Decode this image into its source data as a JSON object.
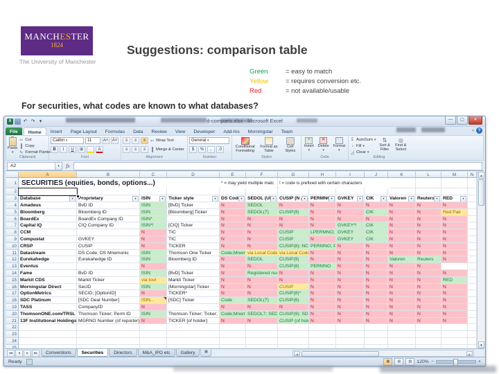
{
  "slide": {
    "logo": {
      "word_main": "MANCH",
      "word_gold": "ES",
      "word_rest": "TER",
      "year": "1824",
      "subtitle": "The University of Manchester"
    },
    "title": "Suggestions: comparison table",
    "legend": [
      {
        "label": "Green",
        "color": "#00a651",
        "desc": "= easy to match"
      },
      {
        "label": "Yellow",
        "color": "#f0c400",
        "desc": "= requires conversion etc."
      },
      {
        "label": "Red",
        "color": "#ee1c25",
        "desc": "= not available/usable"
      }
    ],
    "question": "For securities, what codes are known to what databases?"
  },
  "excel": {
    "window_title": "d-comparis.xlsx - Microsoft Excel",
    "ribbon_tabs": [
      "File",
      "Home",
      "Insert",
      "Page Layout",
      "Formulas",
      "Data",
      "Review",
      "View",
      "Developer",
      "Add-Ins",
      "Morningstar",
      "Team"
    ],
    "active_ribbon_tab": "Home",
    "ribbon": {
      "clipboard": {
        "label": "Clipboard",
        "paste": "Paste",
        "cut": "Cut",
        "copy": "Copy",
        "format_painter": "Format Painter"
      },
      "font": {
        "label": "Font",
        "font_name": "Calibri",
        "font_size": "11"
      },
      "alignment": {
        "label": "Alignment",
        "wrap_text": "Wrap Text",
        "merge_center": "Merge & Center"
      },
      "number": {
        "label": "Number",
        "format": "General"
      },
      "styles": {
        "label": "Styles",
        "conditional": "Conditional Formatting",
        "format_table": "Format as Table",
        "cell_styles": "Cell Styles"
      },
      "cells": {
        "label": "Cells",
        "insert": "Insert",
        "delete": "Delete",
        "format": "Format"
      },
      "editing": {
        "label": "Editing",
        "autosum": "AutoSum",
        "fill": "Fill",
        "clear": "Clear",
        "sort": "Sort & Filter",
        "find": "Find & Select"
      }
    },
    "name_box": "A2",
    "sheet": {
      "column_letters": [
        "A",
        "B",
        "C",
        "D",
        "E",
        "F",
        "G",
        "H",
        "I",
        "J",
        "K",
        "L",
        "M",
        "N"
      ],
      "leading_row_numbers": [
        "1",
        "2",
        "3"
      ],
      "extra_row_numbers": [
        "22",
        "23",
        "24",
        "25"
      ],
      "a1_text": "SECURITIES (equities, bonds, options...)",
      "note1": "* = may yield multiple matc",
      "note2": "! = code is prefixed with certain characters",
      "headers": [
        "Database",
        "Proprietary",
        "ISIN",
        "Ticker style",
        "DS Code",
        "SEDOL (UK)",
        "CUSIP (N Am",
        "PERMNO",
        "GVKEY",
        "CIK",
        "Valoren",
        "Reuters",
        "RED"
      ],
      "rows": [
        {
          "n": "4",
          "db": "Amadeus",
          "prop": "BvD ID",
          "cells": [
            [
              "ISIN",
              "g"
            ],
            [
              "[BvD] Ticker",
              "w"
            ],
            [
              "N",
              "r"
            ],
            [
              "SEDOL",
              "g"
            ],
            [
              "N",
              "r"
            ],
            [
              "N",
              "r"
            ],
            [
              "N",
              "r"
            ],
            [
              "N",
              "r"
            ],
            [
              "N",
              "r"
            ],
            [
              "N",
              "r"
            ],
            [
              "N",
              "r"
            ]
          ]
        },
        {
          "n": "5",
          "db": "Bloomberg",
          "prop": "Bloomberg ID",
          "cells": [
            [
              "ISIN",
              "g"
            ],
            [
              "[Bloomberg] Ticker",
              "w"
            ],
            [
              "N",
              "r"
            ],
            [
              "SEDOL(7)",
              "g"
            ],
            [
              "CUSIP(9)",
              "g"
            ],
            [
              "N",
              "r"
            ],
            [
              "N",
              "r"
            ],
            [
              "CIK",
              "g"
            ],
            [
              "N",
              "r"
            ],
            [
              "N",
              "r"
            ],
            [
              "Red Pair",
              "y"
            ]
          ]
        },
        {
          "n": "6",
          "db": "BoardEx",
          "prop": "BoardEx Company ID",
          "cells": [
            [
              "ISIN*",
              "g"
            ],
            [
              "",
              "w"
            ],
            [
              "N",
              "r"
            ],
            [
              "N",
              "r"
            ],
            [
              "N",
              "r"
            ],
            [
              "N",
              "r"
            ],
            [
              "N",
              "r"
            ],
            [
              "N",
              "r"
            ],
            [
              "N",
              "r"
            ],
            [
              "N",
              "r"
            ],
            [
              "N",
              "r"
            ]
          ]
        },
        {
          "n": "7",
          "db": "Capital IQ",
          "prop": "CIQ Company ID",
          "cells": [
            [
              "ISIN*!",
              "g"
            ],
            [
              "[CIQ] Ticker",
              "w"
            ],
            [
              "N",
              "r"
            ],
            [
              "N",
              "r"
            ],
            [
              "N",
              "r"
            ],
            [
              "N",
              "r"
            ],
            [
              "GVKEY*!",
              "g"
            ],
            [
              "CIK",
              "g"
            ],
            [
              "N",
              "r"
            ],
            [
              "N",
              "r"
            ],
            [
              "N",
              "r"
            ]
          ]
        },
        {
          "n": "8",
          "db": "CCM",
          "prop": "",
          "cells": [
            [
              "N",
              "r"
            ],
            [
              "TIC",
              "w"
            ],
            [
              "N",
              "r"
            ],
            [
              "N",
              "r"
            ],
            [
              "CUSIP",
              "g"
            ],
            [
              "LPERMNO; L",
              "g"
            ],
            [
              "GVKEY",
              "g"
            ],
            [
              "CIK",
              "g"
            ],
            [
              "N",
              "r"
            ],
            [
              "N",
              "r"
            ],
            [
              "N",
              "r"
            ]
          ]
        },
        {
          "n": "9",
          "db": "Compustat",
          "prop": "GVKEY",
          "cells": [
            [
              "N",
              "r"
            ],
            [
              "TIC",
              "w"
            ],
            [
              "N",
              "r"
            ],
            [
              "N",
              "r"
            ],
            [
              "CUSIP",
              "g"
            ],
            [
              "N",
              "r"
            ],
            [
              "GVKEY",
              "g"
            ],
            [
              "CIK",
              "g"
            ],
            [
              "N",
              "r"
            ],
            [
              "N",
              "r"
            ],
            [
              "N",
              "r"
            ]
          ]
        },
        {
          "n": "10",
          "db": "CRSP",
          "prop": "CUSIP",
          "cells": [
            [
              "N",
              "r"
            ],
            [
              "TICKER",
              "w"
            ],
            [
              "N",
              "r"
            ],
            [
              "N",
              "r"
            ],
            [
              "CUSIP(8); NCU",
              "g"
            ],
            [
              "PERMNO; PE",
              "g"
            ],
            [
              "N",
              "r"
            ],
            [
              "N",
              "r"
            ],
            [
              "N",
              "r"
            ],
            [
              "N",
              "r"
            ],
            [
              "N",
              "r"
            ]
          ]
        },
        {
          "n": "11",
          "db": "Datastream",
          "prop": "DS Code; DS Mnemonic",
          "cells": [
            [
              "ISIN",
              "g"
            ],
            [
              "Thomson One Ticker",
              "w"
            ],
            [
              "Code;Mnem",
              "g"
            ],
            [
              "via Local Code",
              "y"
            ],
            [
              "via Local Code",
              "y"
            ],
            [
              "N",
              "r"
            ],
            [
              "N",
              "r"
            ],
            [
              "N",
              "r"
            ],
            [
              "N",
              "r"
            ],
            [
              "N",
              "r"
            ],
            [
              "N",
              "r"
            ]
          ]
        },
        {
          "n": "12",
          "db": "Eurekahedge",
          "prop": "Eurekahedge ID",
          "cells": [
            [
              "ISIN",
              "g"
            ],
            [
              "Bloomberg ID",
              "w"
            ],
            [
              "N",
              "r"
            ],
            [
              "SEDOL",
              "g"
            ],
            [
              "CUSIP(9)",
              "g"
            ],
            [
              "N",
              "r"
            ],
            [
              "N",
              "r"
            ],
            [
              "N",
              "r"
            ],
            [
              "Valoren",
              "g"
            ],
            [
              "Reuters",
              "g"
            ],
            [
              "N",
              "r"
            ]
          ]
        },
        {
          "n": "13",
          "db": "Eventus",
          "prop": "",
          "cells": [
            [
              "N",
              "r"
            ],
            [
              "",
              "w"
            ],
            [
              "N",
              "r"
            ],
            [
              "N",
              "r"
            ],
            [
              "CUSIP(8)",
              "g"
            ],
            [
              "PERMNO",
              "g"
            ],
            [
              "N",
              "r"
            ],
            [
              "N",
              "r"
            ],
            [
              "N",
              "r"
            ],
            [
              "N",
              "r"
            ],
            [
              "",
              "w"
            ]
          ]
        },
        {
          "n": "14",
          "db": "Fame",
          "prop": "BvD ID",
          "cells": [
            [
              "ISIN",
              "g"
            ],
            [
              "[BvD] Ticker",
              "w"
            ],
            [
              "N",
              "r"
            ],
            [
              "Registered num",
              "g"
            ],
            [
              "N",
              "r"
            ],
            [
              "N",
              "r"
            ],
            [
              "N",
              "r"
            ],
            [
              "N",
              "r"
            ],
            [
              "N",
              "r"
            ],
            [
              "N",
              "r"
            ],
            [
              "N",
              "r"
            ]
          ]
        },
        {
          "n": "15",
          "db": "Markit CDS",
          "prop": "Markit Ticker",
          "cells": [
            [
              "via tool",
              "y"
            ],
            [
              "Markit Ticker",
              "w"
            ],
            [
              "N",
              "r"
            ],
            [
              "N",
              "r"
            ],
            [
              "N",
              "r"
            ],
            [
              "N",
              "r"
            ],
            [
              "N",
              "r"
            ],
            [
              "N",
              "r"
            ],
            [
              "N",
              "r"
            ],
            [
              "N",
              "r"
            ],
            [
              "RED",
              "g"
            ]
          ]
        },
        {
          "n": "16",
          "db": "Morningstar Direct",
          "prop": "SecID",
          "cells": [
            [
              "ISIN",
              "g"
            ],
            [
              "[Morningstar] Ticker",
              "w"
            ],
            [
              "N",
              "r"
            ],
            [
              "N",
              "r"
            ],
            [
              "CUSIP",
              "y"
            ],
            [
              "N",
              "r"
            ],
            [
              "N",
              "r"
            ],
            [
              "N",
              "r"
            ],
            [
              "N",
              "r"
            ],
            [
              "N",
              "r"
            ],
            [
              "N",
              "r"
            ]
          ]
        },
        {
          "n": "17",
          "db": "OptionMetrics",
          "prop": "SECID; [OptionID]",
          "cells": [
            [
              "N",
              "r"
            ],
            [
              "TICKER*",
              "w"
            ],
            [
              "N",
              "r"
            ],
            [
              "N",
              "r"
            ],
            [
              "CUSIP(8)*",
              "g"
            ],
            [
              "N",
              "r"
            ],
            [
              "N",
              "r"
            ],
            [
              "N",
              "r"
            ],
            [
              "N",
              "r"
            ],
            [
              "N",
              "r"
            ],
            [
              "N",
              "r"
            ]
          ]
        },
        {
          "n": "18",
          "db": "SDC Platinum",
          "prop": "[SDC Deal Number]",
          "cells": [
            [
              "ISIN...",
              "y",
              "c"
            ],
            [
              "[SDC] Ticker",
              "w"
            ],
            [
              "Code",
              "g"
            ],
            [
              "SEDOL(7)",
              "g"
            ],
            [
              "CUSIP(6)",
              "g"
            ],
            [
              "N",
              "r"
            ],
            [
              "N",
              "r"
            ],
            [
              "N",
              "r"
            ],
            [
              "N",
              "r"
            ],
            [
              "N",
              "r"
            ],
            [
              "N",
              "r"
            ]
          ]
        },
        {
          "n": "19",
          "db": "TASS",
          "prop": "CompanyID",
          "cells": [
            [
              "N",
              "r"
            ],
            [
              "",
              "w"
            ],
            [
              "N",
              "r"
            ],
            [
              "N",
              "r"
            ],
            [
              "N",
              "r"
            ],
            [
              "N",
              "r"
            ],
            [
              "N",
              "r"
            ],
            [
              "N",
              "r"
            ],
            [
              "N",
              "r"
            ],
            [
              "N",
              "r"
            ],
            [
              "N",
              "r"
            ]
          ]
        },
        {
          "n": "20",
          "db": "ThomsonONE.com/TRSL",
          "prop": "Thomson Ticker; Perm ID",
          "cells": [
            [
              "ISIN",
              "g"
            ],
            [
              "Thomson Ticker; Ticker; I",
              "w"
            ],
            [
              "Code;Mnem",
              "g"
            ],
            [
              "SEDOL7; SEDOL",
              "g"
            ],
            [
              "CUSIP(9); SDC",
              "g"
            ],
            [
              "N",
              "r"
            ],
            [
              "N",
              "r"
            ],
            [
              "N",
              "r"
            ],
            [
              "N",
              "r"
            ],
            [
              "N",
              "r"
            ],
            [
              "N",
              "r"
            ]
          ]
        },
        {
          "n": "21",
          "db": "13F Institutional Holdings",
          "prop": "MGRNO Number (of reporter)",
          "cells": [
            [
              "N",
              "r"
            ],
            [
              "TICKER [of holder]",
              "w"
            ],
            [
              "N",
              "r"
            ],
            [
              "N",
              "r"
            ],
            [
              "CUSIP (of hold",
              "g"
            ],
            [
              "N",
              "r"
            ],
            [
              "N",
              "r"
            ],
            [
              "N",
              "r"
            ],
            [
              "N",
              "r"
            ],
            [
              "N",
              "r"
            ],
            [
              "N",
              "r"
            ]
          ]
        }
      ]
    },
    "sheet_tabs": [
      "Conventions",
      "Securities",
      "Directors",
      "M&A_IPO etc",
      "Gallery"
    ],
    "active_sheet": "Securities",
    "status": {
      "ready": "Ready",
      "zoom": "120%"
    }
  }
}
